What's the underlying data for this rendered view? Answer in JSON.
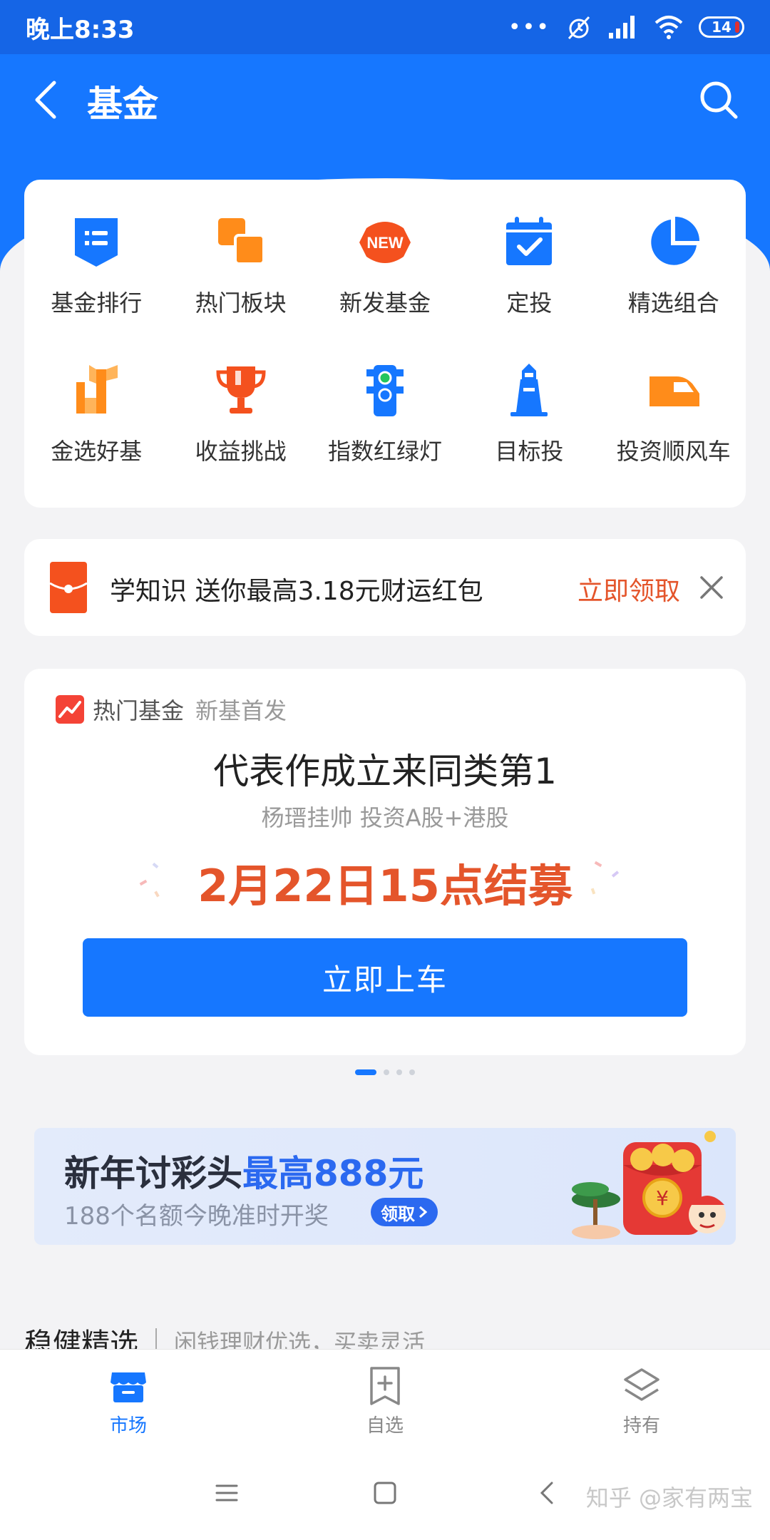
{
  "status_bar": {
    "time": "晚上8:33",
    "dots": "•••",
    "battery": "14"
  },
  "nav": {
    "title": "基金"
  },
  "grid": [
    {
      "label": "基金排行",
      "icon": "ranking-icon"
    },
    {
      "label": "热门板块",
      "icon": "hot-sectors-icon"
    },
    {
      "label": "新发基金",
      "icon": "new-badge-icon",
      "badge": "NEW"
    },
    {
      "label": "定投",
      "icon": "calendar-check-icon"
    },
    {
      "label": "精选组合",
      "icon": "pie-chart-icon"
    },
    {
      "label": "金选好基",
      "icon": "trophy-cup-icon"
    },
    {
      "label": "收益挑战",
      "icon": "trophy-icon"
    },
    {
      "label": "指数红绿灯",
      "icon": "traffic-light-icon"
    },
    {
      "label": "目标投",
      "icon": "lighthouse-icon"
    },
    {
      "label": "投资顺风车",
      "icon": "train-icon"
    }
  ],
  "promo": {
    "text": "学知识 送你最高3.18元财运红包",
    "cta": "立即领取"
  },
  "fund_card": {
    "tag": "热门基金",
    "tag_sub": "新基首发",
    "headline": "代表作成立来同类第1",
    "subline": "杨瑨挂帅 投资A股+港股",
    "date": "2月22日15点结募",
    "button": "立即上车"
  },
  "banner": {
    "title_prefix": "新年讨彩头",
    "title_highlight": "最高888元",
    "sub": "188个名额今晚准时开奖",
    "button": "领取"
  },
  "section": {
    "title": "稳健精选",
    "sub": "闲钱理财优选，买卖灵活"
  },
  "tabs": [
    {
      "label": "市场",
      "active": true
    },
    {
      "label": "自选",
      "active": false
    },
    {
      "label": "持有",
      "active": false
    }
  ],
  "watermark": "知乎 @家有两宝",
  "colors": {
    "primary": "#1677ff",
    "accent_red": "#e4552b",
    "orange": "#ff8c1a"
  }
}
